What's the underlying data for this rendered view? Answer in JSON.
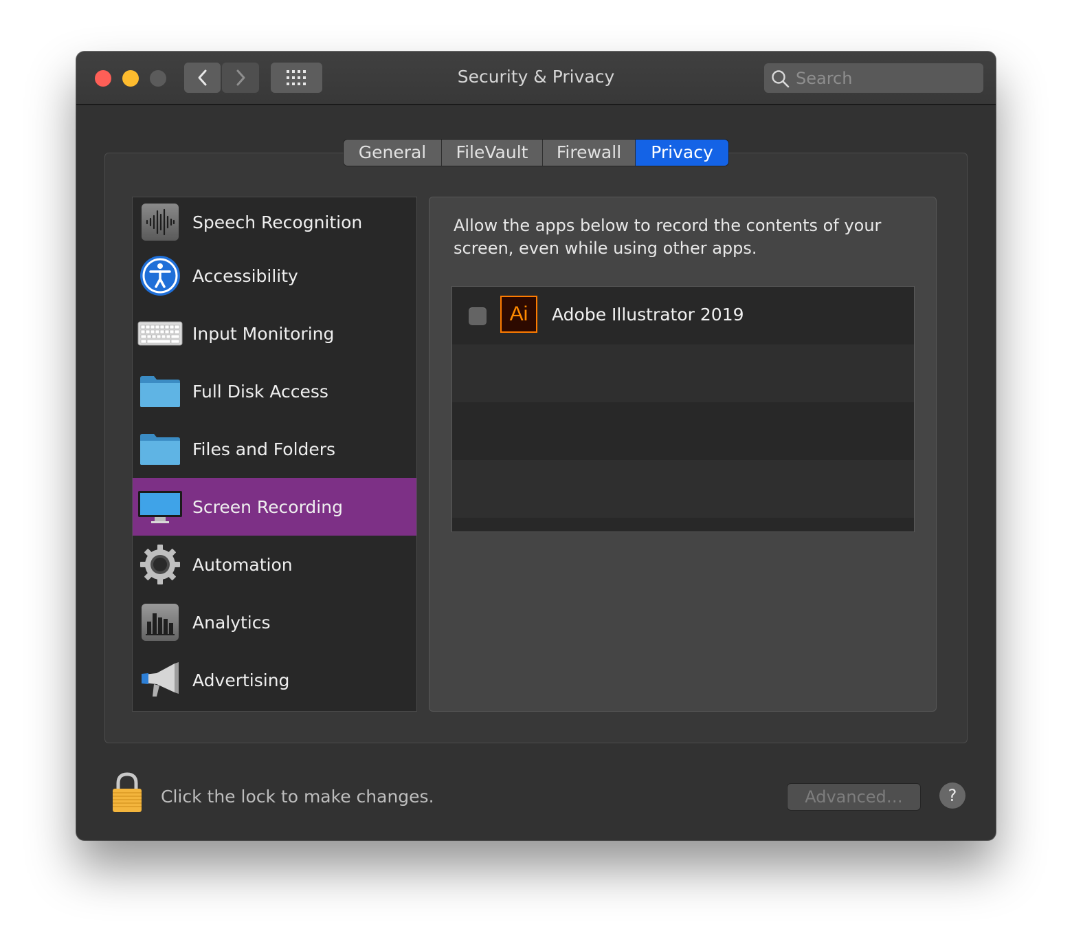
{
  "window": {
    "title": "Security & Privacy",
    "search": {
      "placeholder": "Search",
      "value": ""
    }
  },
  "tabs": [
    {
      "label": "General",
      "active": false
    },
    {
      "label": "FileVault",
      "active": false
    },
    {
      "label": "Firewall",
      "active": false
    },
    {
      "label": "Privacy",
      "active": true
    }
  ],
  "sidebar": {
    "items": [
      {
        "label": "Speech Recognition",
        "icon": "waveform-icon",
        "selected": false
      },
      {
        "label": "Accessibility",
        "icon": "accessibility-icon",
        "selected": false
      },
      {
        "label": "Input Monitoring",
        "icon": "keyboard-icon",
        "selected": false
      },
      {
        "label": "Full Disk Access",
        "icon": "folder-icon",
        "selected": false
      },
      {
        "label": "Files and Folders",
        "icon": "folder-icon",
        "selected": false
      },
      {
        "label": "Screen Recording",
        "icon": "display-icon",
        "selected": true
      },
      {
        "label": "Automation",
        "icon": "gear-icon",
        "selected": false
      },
      {
        "label": "Analytics",
        "icon": "bar-chart-icon",
        "selected": false
      },
      {
        "label": "Advertising",
        "icon": "megaphone-icon",
        "selected": false
      }
    ]
  },
  "main": {
    "description": "Allow the apps below to record the contents of your screen, even while using other apps.",
    "apps": [
      {
        "name": "Adobe Illustrator 2019",
        "icon_text": "Ai",
        "checked": false
      }
    ]
  },
  "footer": {
    "lock_text": "Click the lock to make changes.",
    "advanced_label": "Advanced…",
    "help_label": "?"
  },
  "colors": {
    "accent": "#1463e6",
    "selection": "#7d3086",
    "window_bg": "#323232"
  }
}
